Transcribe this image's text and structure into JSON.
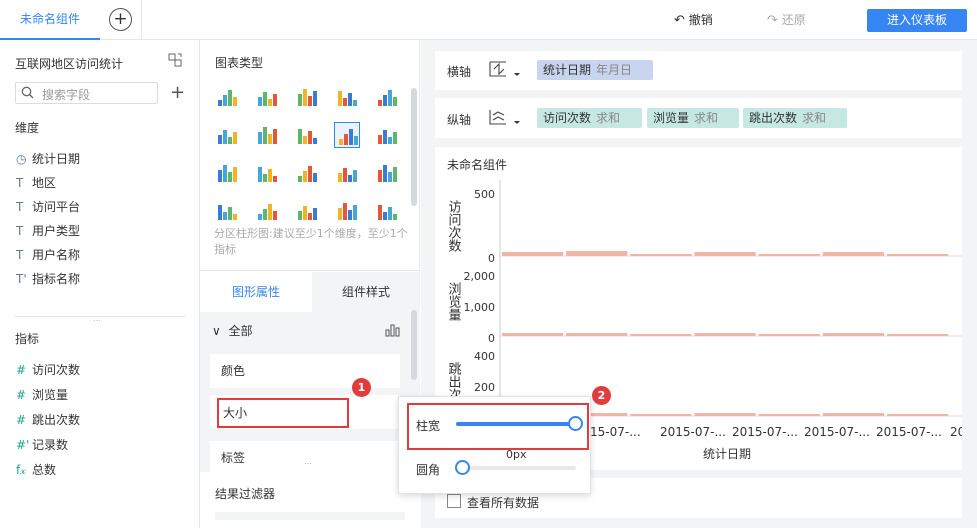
{
  "top": {
    "tab_label": "未命名组件",
    "undo_label": "撤销",
    "redo_label": "还原",
    "enter_dashboard_label": "进入仪表板"
  },
  "left": {
    "dataset_title": "互联网地区访问统计",
    "search_placeholder": "搜索字段",
    "dimension_header": "维度",
    "dimensions": [
      "统计日期",
      "地区",
      "访问平台",
      "用户类型",
      "用户名称",
      "指标名称"
    ],
    "measure_header": "指标",
    "measures": [
      "访问次数",
      "浏览量",
      "跳出次数",
      "记录数",
      "总数"
    ]
  },
  "mid": {
    "chart_type_header": "图表类型",
    "chart_hint": "分区柱形图:建议至少1个维度，至少1个指标",
    "tab_shape": "图形属性",
    "tab_style": "组件样式",
    "all_label": "全部",
    "prop_color": "颜色",
    "prop_size": "大小",
    "prop_label": "标签",
    "result_filter": "结果过滤器"
  },
  "right": {
    "x_axis_label": "横轴",
    "x_field": "统计日期",
    "x_field_agg": "年月日",
    "y_axis_label": "纵轴",
    "y_fields": [
      {
        "name": "访问次数",
        "agg": "求和"
      },
      {
        "name": "浏览量",
        "agg": "求和"
      },
      {
        "name": "跳出次数",
        "agg": "求和"
      }
    ],
    "component_title": "未命名组件",
    "view_all_data": "查看所有数据"
  },
  "popup": {
    "bar_width_label": "柱宽",
    "corner_label": "圆角",
    "px_label": "0px",
    "bar_width_value": 1.0,
    "corner_value": 0.0
  },
  "badges": [
    "1",
    "2"
  ],
  "chart_data": {
    "type": "bar",
    "xlabel": "统计日期",
    "categories": [
      "15-07-...",
      "2015-07-...",
      "2015-07-...",
      "2015-07-...",
      "2015-07-...",
      "20"
    ],
    "panels": [
      {
        "name": "访问次数",
        "yticks": [
          "500",
          "0"
        ],
        "ylim": [
          0,
          600
        ]
      },
      {
        "name": "浏览量",
        "yticks": [
          "2,000",
          "1,000",
          "0"
        ],
        "ylim": [
          0,
          2200
        ]
      },
      {
        "name": "跳出次数",
        "yticks": [
          "400",
          "200",
          "0"
        ],
        "ylim": [
          0,
          450
        ]
      }
    ]
  },
  "colors": {
    "accent": "#3685f2",
    "bar": "#efb6a6",
    "badge": "#e23b3b"
  }
}
